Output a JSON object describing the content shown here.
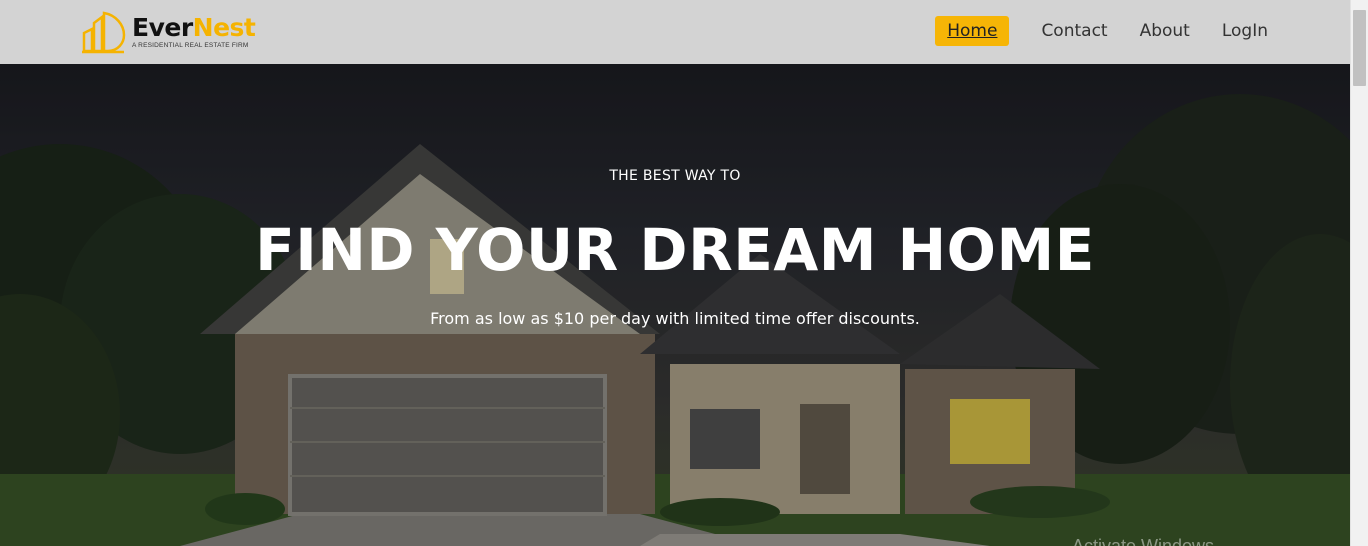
{
  "brand": {
    "name_part1": "Ever",
    "name_part2": "Nest",
    "tagline": "A RESIDENTIAL REAL ESTATE FIRM",
    "accent_color": "#f5b301"
  },
  "nav": {
    "items": [
      {
        "label": "Home",
        "active": true
      },
      {
        "label": "Contact",
        "active": false
      },
      {
        "label": "About",
        "active": false
      },
      {
        "label": "LogIn",
        "active": false
      }
    ],
    "active_color": "#f6b506"
  },
  "hero": {
    "eyebrow": "THE BEST WAY TO",
    "title": "FIND YOUR DREAM HOME",
    "subtitle": "From as low as $10 per day with limited time offer discounts.",
    "watermark": "Activate Windows"
  }
}
